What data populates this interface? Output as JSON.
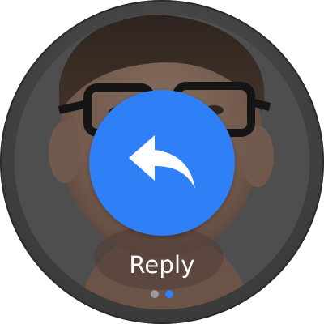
{
  "action": {
    "label": "Reply",
    "icon": "reply-icon",
    "button_color": "#2f80f7"
  },
  "pager": {
    "count": 2,
    "active_index": 1,
    "active_color": "#2f80f7",
    "inactive_color": "#9a9a9a"
  }
}
